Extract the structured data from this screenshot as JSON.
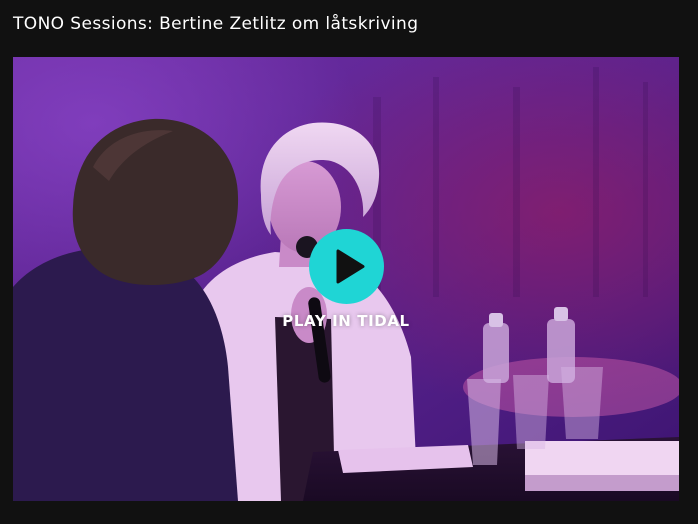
{
  "embed": {
    "title": "TONO Sessions: Bertine Zetlitz om låtskriving",
    "play_label": "PLAY IN TIDAL",
    "play_icon": "play-icon",
    "colors": {
      "background": "#111111",
      "title_text": "#ffffff",
      "play_button": "#1fd5d5",
      "play_icon": "#111111"
    }
  }
}
